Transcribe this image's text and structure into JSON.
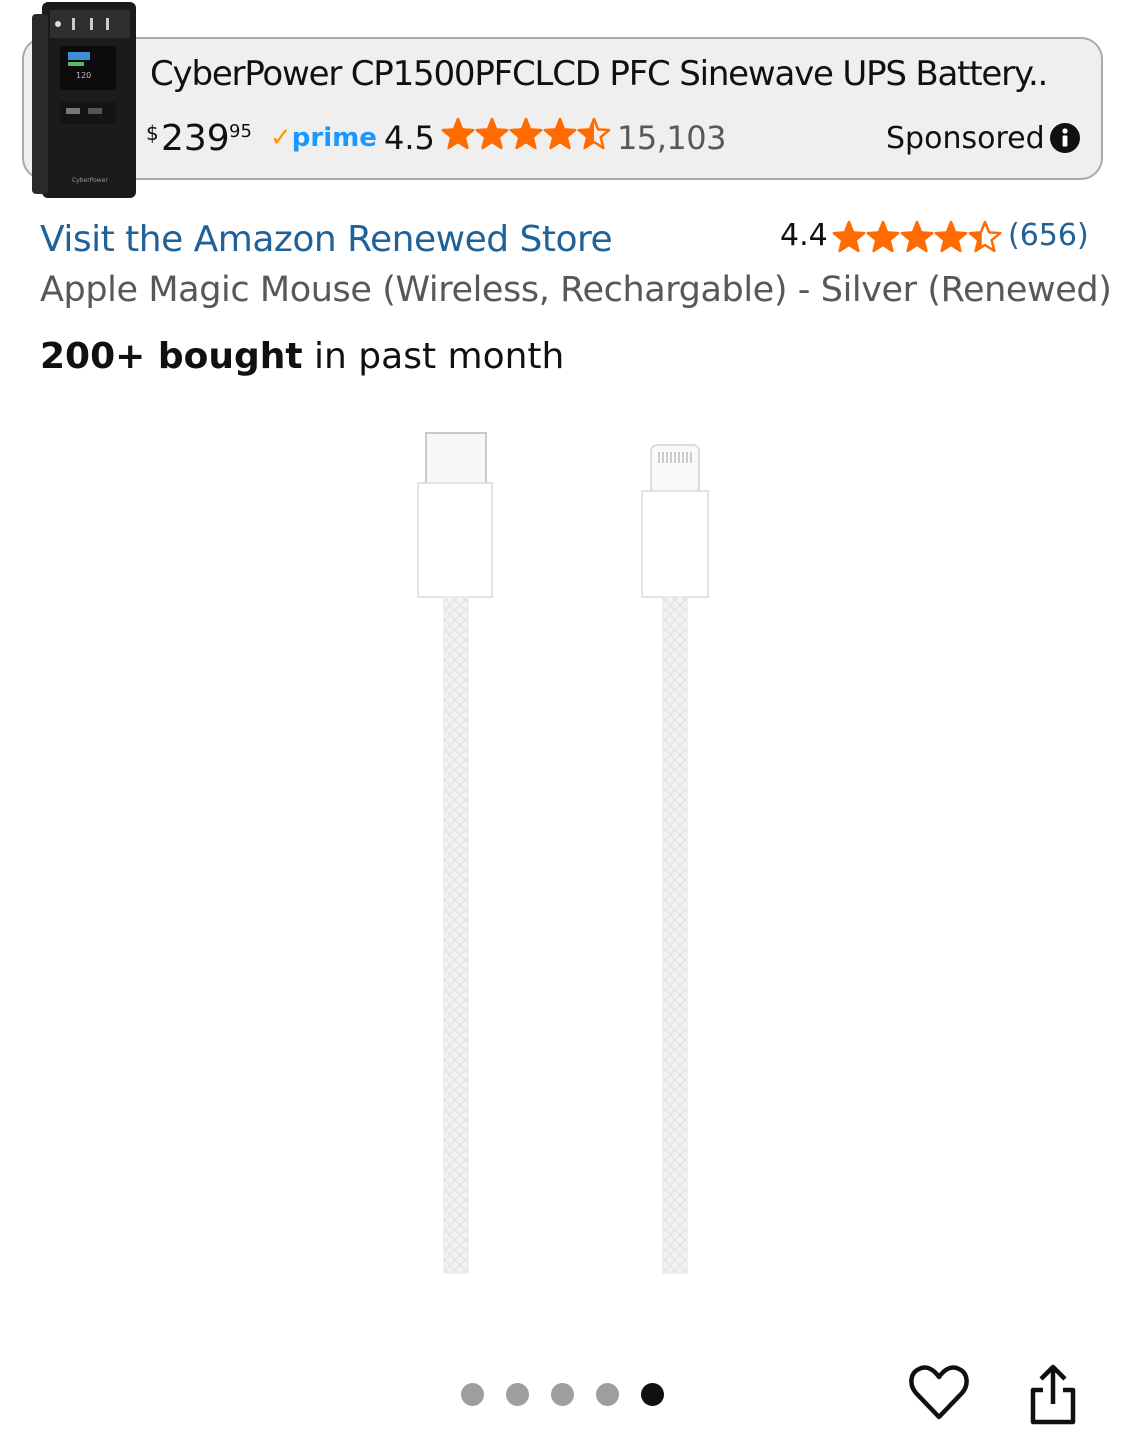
{
  "ad": {
    "title": "CyberPower CP1500PFCLCD PFC Sinewave UPS Battery...",
    "price_currency": "$",
    "price_whole": "239",
    "price_fraction": "95",
    "prime_label": "prime",
    "rating": "4.5",
    "rating_value": 4.5,
    "review_count": "15,103",
    "sponsored_label": "Sponsored",
    "product_image_icon": "ups-battery-tower-image",
    "info_icon": "info-icon"
  },
  "product": {
    "store_link": "Visit the Amazon Renewed Store",
    "rating": "4.4",
    "rating_value": 4.4,
    "review_count": "(656)",
    "title": "Apple Magic Mouse (Wireless, Rechargable) - Silver (Renewed)",
    "bought_bold": "200+ bought",
    "bought_rest": " in past month",
    "image_icon": "usb-c-to-lightning-cable-image"
  },
  "carousel": {
    "total": 5,
    "active_index": 4
  },
  "actions": {
    "favorite_icon": "heart-icon",
    "share_icon": "share-icon"
  },
  "colors": {
    "star": "#ff6b00",
    "link": "#1f6199",
    "prime": "#1a98ff",
    "ad_background": "#efefef"
  }
}
